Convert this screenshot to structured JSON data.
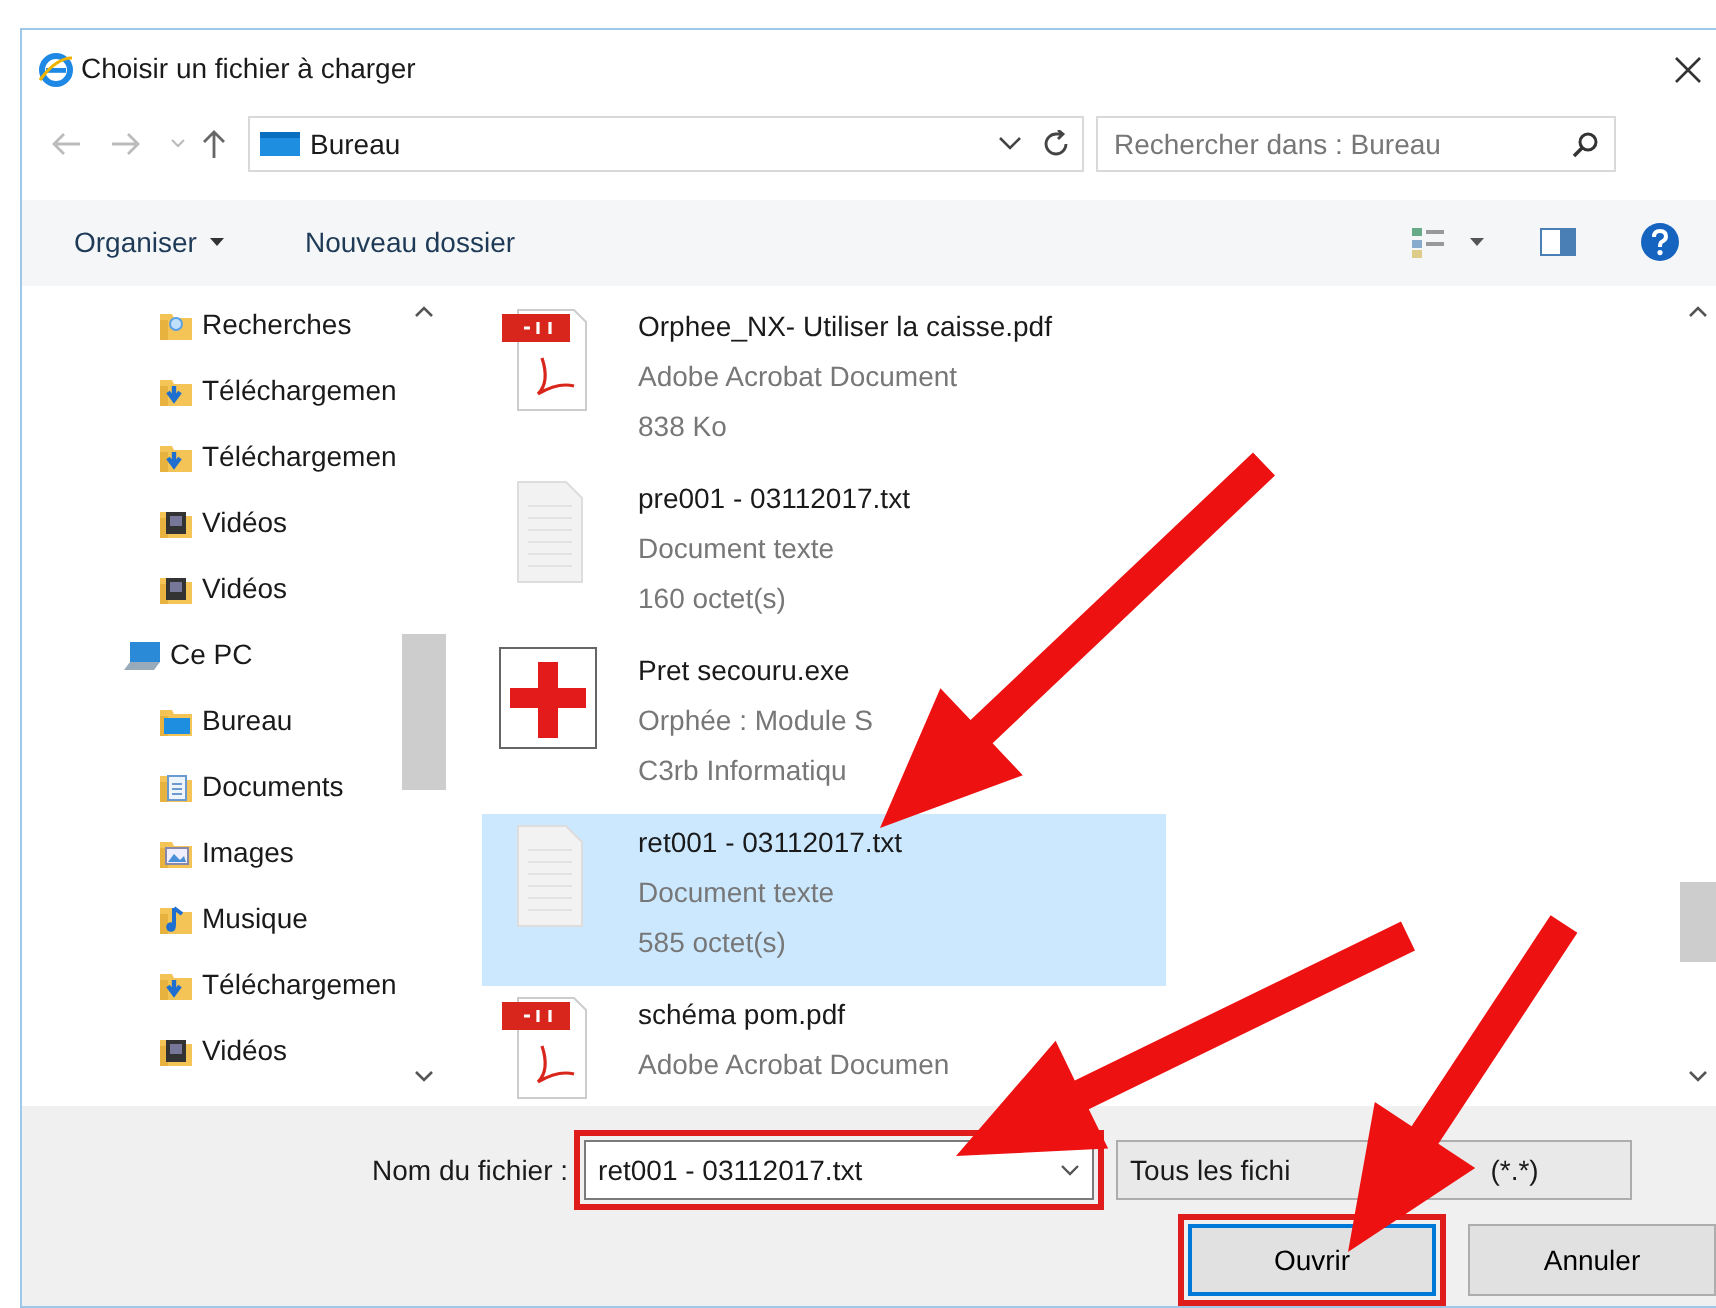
{
  "window": {
    "title": "Choisir un fichier à charger"
  },
  "address": {
    "location": "Bureau"
  },
  "search": {
    "placeholder": "Rechercher dans : Bureau"
  },
  "toolbar": {
    "organize": "Organiser",
    "new_folder": "Nouveau dossier"
  },
  "navigation": [
    {
      "label": "Recherches",
      "kind": "search"
    },
    {
      "label": "Téléchargemen",
      "kind": "download"
    },
    {
      "label": "Téléchargemen",
      "kind": "download"
    },
    {
      "label": "Vidéos",
      "kind": "video"
    },
    {
      "label": "Vidéos",
      "kind": "video"
    },
    {
      "label": "Ce PC",
      "kind": "pc",
      "children": [
        {
          "label": "Bureau",
          "kind": "desktop"
        },
        {
          "label": "Documents",
          "kind": "documents"
        },
        {
          "label": "Images",
          "kind": "images"
        },
        {
          "label": "Musique",
          "kind": "music"
        },
        {
          "label": "Téléchargemen",
          "kind": "download"
        },
        {
          "label": "Vidéos",
          "kind": "video"
        }
      ]
    }
  ],
  "files": [
    {
      "name": "Orphee_NX- Utiliser la caisse.pdf",
      "type": "Adobe Acrobat Document",
      "detail": "838 Ko",
      "kind": "pdf",
      "selected": false
    },
    {
      "name": "pre001 - 03112017.txt",
      "type": "Document texte",
      "detail": "160 octet(s)",
      "kind": "txt",
      "selected": false
    },
    {
      "name": "Pret secouru.exe",
      "type": "Orphée : Module S",
      "detail": "C3rb Informatiqu",
      "kind": "exe",
      "selected": false
    },
    {
      "name": "ret001 - 03112017.txt",
      "type": "Document texte",
      "detail": "585 octet(s)",
      "kind": "txt",
      "selected": true
    },
    {
      "name": "schéma pom.pdf",
      "type": "Adobe Acrobat Documen",
      "kind": "pdf",
      "selected": false
    }
  ],
  "filename": {
    "label": "Nom du fichier :",
    "value": "ret001 - 03112017.txt",
    "highlighted": true
  },
  "filter": {
    "value_parts": [
      "Tous les fichi",
      "(*.*)"
    ]
  },
  "buttons": [
    {
      "label": "Ouvrir",
      "kind": "default",
      "highlighted": true
    },
    {
      "label": "Annuler",
      "kind": "plain",
      "highlighted": false
    }
  ],
  "annotations": [
    {
      "kind": "arrow"
    },
    {
      "kind": "arrow"
    },
    {
      "kind": "arrow"
    }
  ]
}
